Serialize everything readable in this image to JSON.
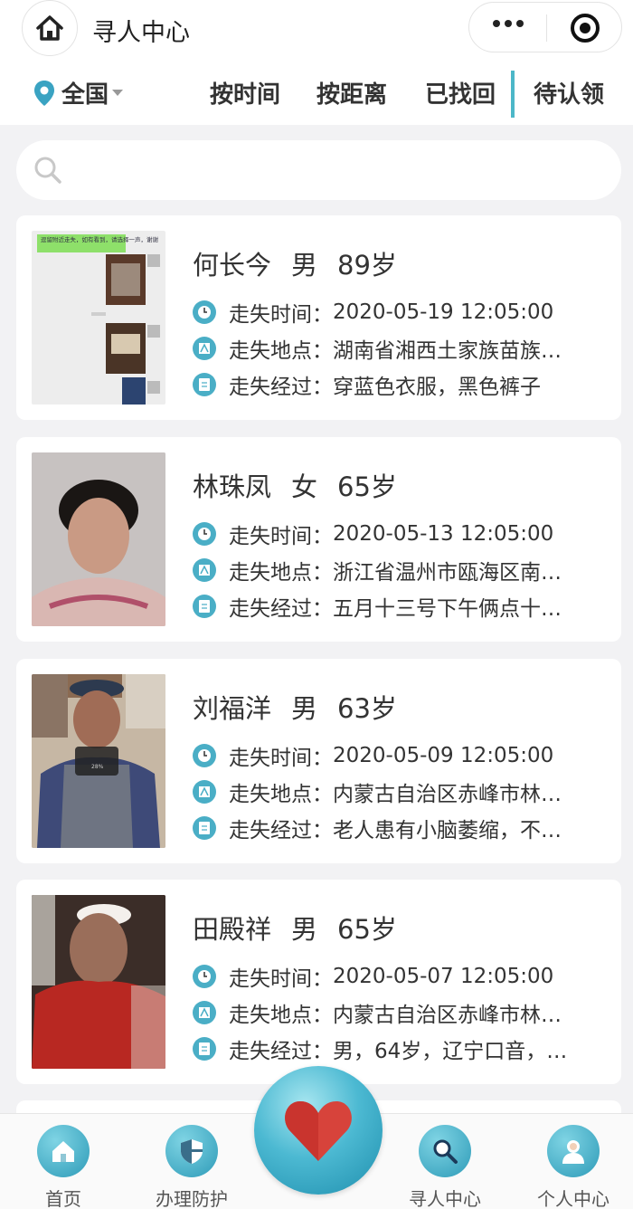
{
  "header": {
    "title": "寻人中心",
    "home_icon": "home-icon",
    "more_icon": "more-icon",
    "close_icon": "record-icon"
  },
  "filters": {
    "region": "全国",
    "tabs": [
      "按时间",
      "按距离",
      "已找回",
      "待认领"
    ]
  },
  "search": {
    "placeholder": ""
  },
  "persons": [
    {
      "name": "何长今",
      "gender": "男",
      "age": "89岁",
      "time_label": "走失时间：",
      "time": "2020-05-19 12:05:00",
      "place_label": "走失地点：",
      "place": "湖南省湘西土家族苗族…",
      "desc_label": "走失经过：",
      "desc": "穿蓝色衣服，黑色裤子",
      "photo_caption": "逗留附近走失，如有看到，请选择一声，谢谢"
    },
    {
      "name": "林珠凤",
      "gender": "女",
      "age": "65岁",
      "time_label": "走失时间：",
      "time": "2020-05-13 12:05:00",
      "place_label": "走失地点：",
      "place": "浙江省温州市瓯海区南…",
      "desc_label": "走失经过：",
      "desc": "五月十三号下午俩点十…"
    },
    {
      "name": "刘福洋",
      "gender": "男",
      "age": "63岁",
      "time_label": "走失时间：",
      "time": "2020-05-09 12:05:00",
      "place_label": "走失地点：",
      "place": "内蒙古自治区赤峰市林…",
      "desc_label": "走失经过：",
      "desc": "老人患有小脑萎缩，不…",
      "photo_caption": "28%"
    },
    {
      "name": "田殿祥",
      "gender": "男",
      "age": "65岁",
      "time_label": "走失时间：",
      "time": "2020-05-07 12:05:00",
      "place_label": "走失地点：",
      "place": "内蒙古自治区赤峰市林…",
      "desc_label": "走失经过：",
      "desc": "男，64岁，辽宁口音，…"
    }
  ],
  "bottom_nav": [
    {
      "label": "首页",
      "icon": "home-icon"
    },
    {
      "label": "办理防护",
      "icon": "shield-icon"
    },
    {
      "label": "",
      "icon": "heart-icon"
    },
    {
      "label": "寻人中心",
      "icon": "search-icon"
    },
    {
      "label": "个人中心",
      "icon": "user-icon"
    }
  ],
  "colors": {
    "accent": "#4aaec6",
    "heart": "#d7433b",
    "background": "#f2f2f4"
  }
}
